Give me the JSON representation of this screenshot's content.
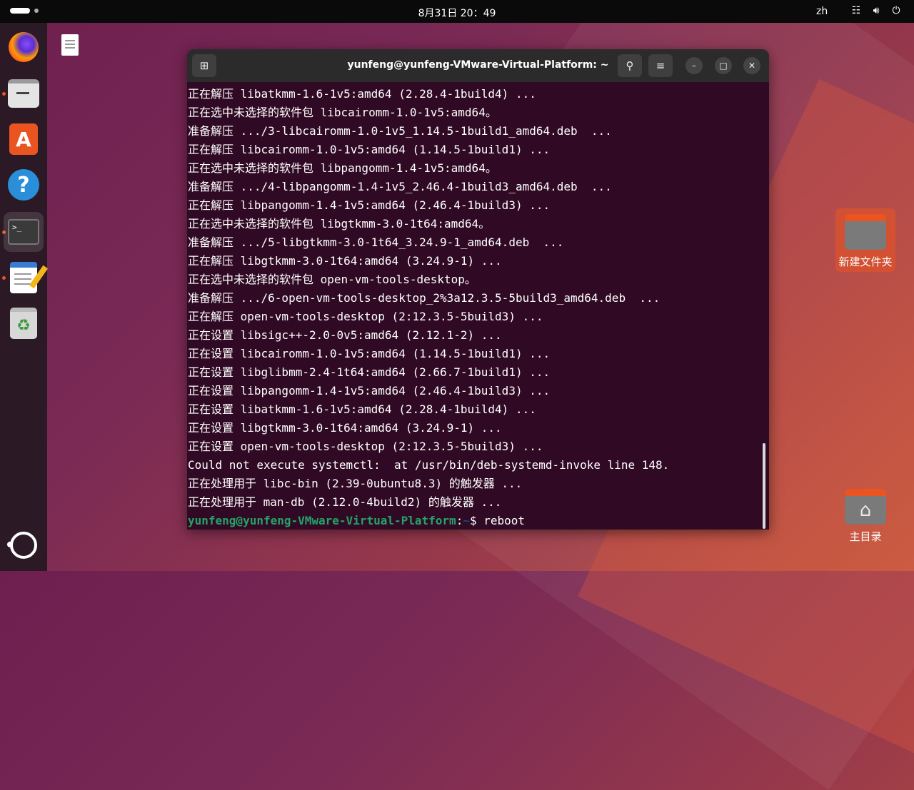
{
  "topbar": {
    "clock": "8月31日  20：49",
    "language": "zh",
    "tray_icons": [
      "network-icon",
      "volume-icon",
      "power-icon"
    ]
  },
  "dock": {
    "items": [
      "firefox",
      "files",
      "app-center",
      "help",
      "terminal",
      "text-editor",
      "trash",
      "show-apps"
    ],
    "terminal_icon_text": ">_"
  },
  "desktop": {
    "folders": [
      {
        "label": "新建文件夹",
        "selected": true
      },
      {
        "label": "主目录",
        "selected": false
      }
    ]
  },
  "terminal": {
    "title": "yunfeng@yunfeng-VMware-Virtual-Platform: ~",
    "lines": [
      "正在解压 libatkmm-1.6-1v5:amd64 (2.28.4-1build4) ...",
      "正在选中未选择的软件包 libcairomm-1.0-1v5:amd64。",
      "准备解压 .../3-libcairomm-1.0-1v5_1.14.5-1build1_amd64.deb  ...",
      "正在解压 libcairomm-1.0-1v5:amd64 (1.14.5-1build1) ...",
      "正在选中未选择的软件包 libpangomm-1.4-1v5:amd64。",
      "准备解压 .../4-libpangomm-1.4-1v5_2.46.4-1build3_amd64.deb  ...",
      "正在解压 libpangomm-1.4-1v5:amd64 (2.46.4-1build3) ...",
      "正在选中未选择的软件包 libgtkmm-3.0-1t64:amd64。",
      "准备解压 .../5-libgtkmm-3.0-1t64_3.24.9-1_amd64.deb  ...",
      "正在解压 libgtkmm-3.0-1t64:amd64 (3.24.9-1) ...",
      "正在选中未选择的软件包 open-vm-tools-desktop。",
      "准备解压 .../6-open-vm-tools-desktop_2%3a12.3.5-5build3_amd64.deb  ...",
      "正在解压 open-vm-tools-desktop (2:12.3.5-5build3) ...",
      "正在设置 libsigc++-2.0-0v5:amd64 (2.12.1-2) ...",
      "正在设置 libcairomm-1.0-1v5:amd64 (1.14.5-1build1) ...",
      "正在设置 libglibmm-2.4-1t64:amd64 (2.66.7-1build1) ...",
      "正在设置 libpangomm-1.4-1v5:amd64 (2.46.4-1build3) ...",
      "正在设置 libatkmm-1.6-1v5:amd64 (2.28.4-1build4) ...",
      "正在设置 libgtkmm-3.0-1t64:amd64 (3.24.9-1) ...",
      "正在设置 open-vm-tools-desktop (2:12.3.5-5build3) ...",
      "Could not execute systemctl:  at /usr/bin/deb-systemd-invoke line 148.",
      "正在处理用于 libc-bin (2.39-0ubuntu8.3) 的触发器 ...",
      "正在处理用于 man-db (2.12.0-4build2) 的触发器 ..."
    ],
    "prompt": {
      "user_host": "yunfeng@yunfeng-VMware-Virtual-Platform",
      "separator": ":",
      "path": "~",
      "symbol": "$ ",
      "command": "reboot"
    }
  },
  "colors": {
    "terminal_bg": "#300a24",
    "prompt_user": "#26a269",
    "prompt_path": "#12488b",
    "accent": "#e95420"
  }
}
